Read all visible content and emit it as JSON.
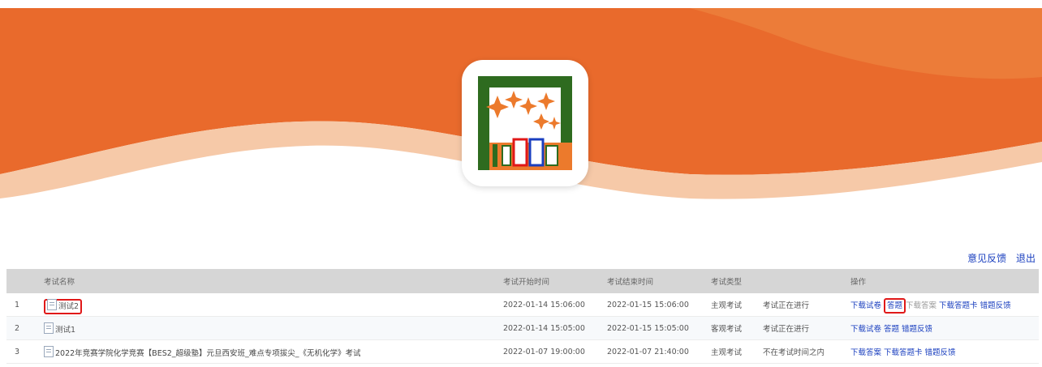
{
  "header": {
    "links": [
      "意见反馈",
      "退出"
    ]
  },
  "brand": {
    "logo": "blodo-app-logo",
    "colors": {
      "banner_orange": "#e96a2c",
      "banner_light": "#f6c9a8",
      "logo_green": "#2e6b1f",
      "logo_orange": "#ec7a2c"
    }
  },
  "table": {
    "columns": [
      "考试名称",
      "考试开始时间",
      "考试结束时间",
      "考试类型",
      "",
      "操作"
    ],
    "rows": [
      {
        "index": "1",
        "name": "测试2",
        "start": "2022-01-14 15:06:00",
        "end": "2022-01-15 15:06:00",
        "type": "主观考试",
        "status": "考试正在进行",
        "ops": {
          "download_paper": "下载试卷",
          "answer": "答题",
          "download_answer": "下载答案",
          "download_card": "下载答题卡",
          "error_feedback": "错题反馈"
        }
      },
      {
        "index": "2",
        "name": "测试1",
        "start": "2022-01-14 15:05:00",
        "end": "2022-01-15 15:05:00",
        "type": "客观考试",
        "status": "考试正在进行",
        "ops": {
          "download_paper": "下载试卷",
          "answer": "答题",
          "error_feedback": "错题反馈"
        }
      },
      {
        "index": "3",
        "name": "2022年竞赛学院化学竞赛【BES2_超级塾】元旦西安班_难点专项拔尖_《无机化学》考试",
        "start": "2022-01-07 19:00:00",
        "end": "2022-01-07 21:40:00",
        "type": "主观考试",
        "status": "不在考试时间之内",
        "ops": {
          "download_answer": "下载答案",
          "download_card": "下载答题卡",
          "error_feedback": "错题反馈"
        }
      }
    ]
  }
}
